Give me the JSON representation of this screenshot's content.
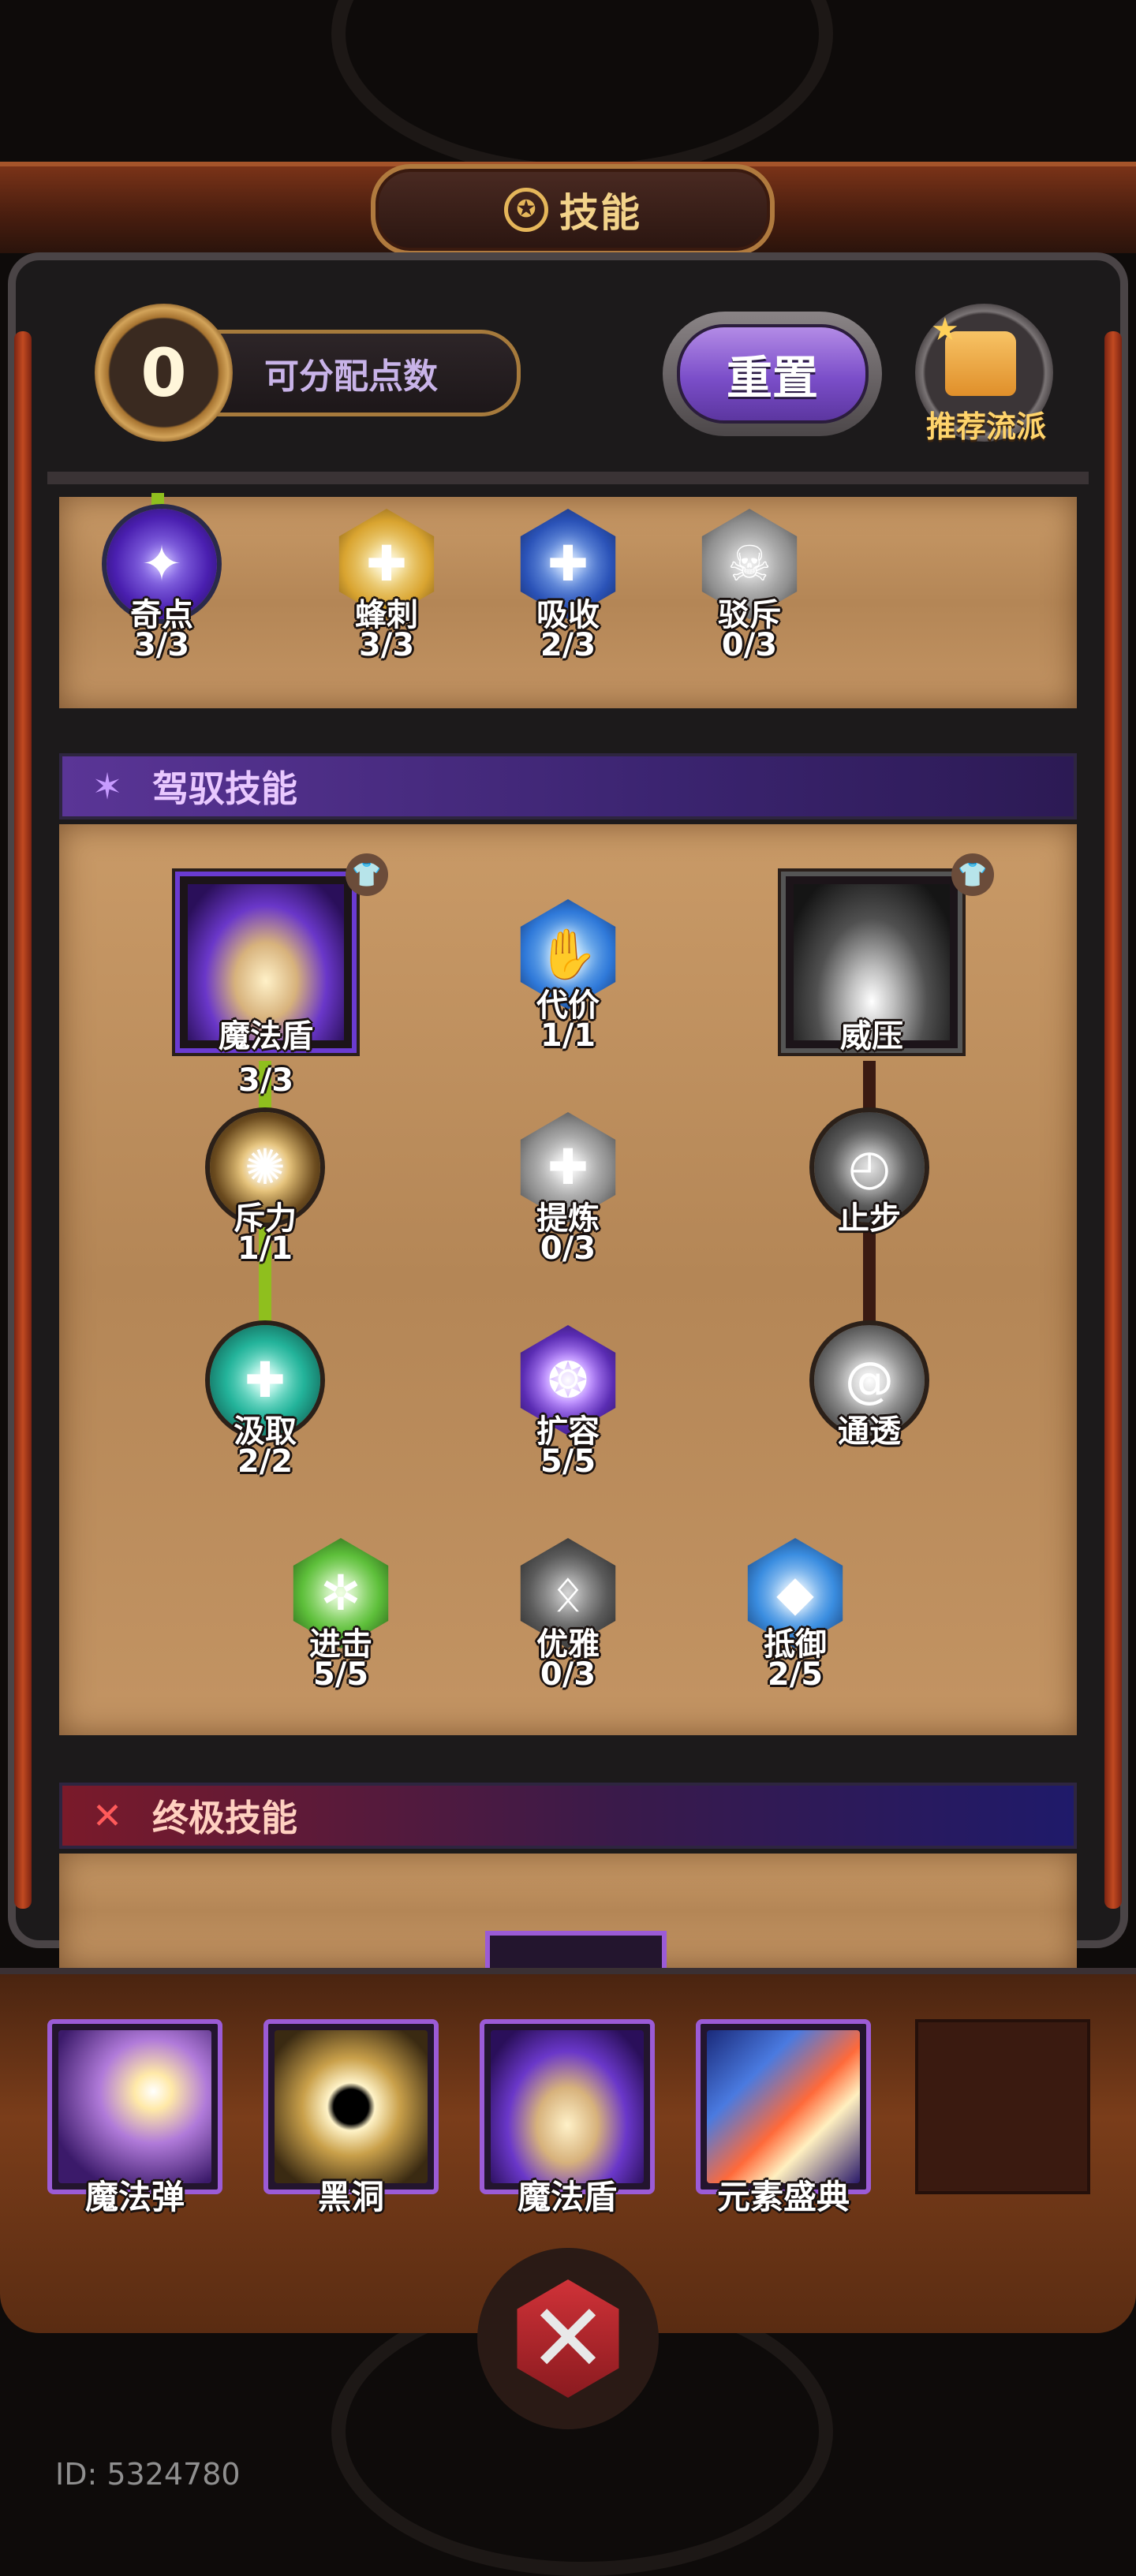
{
  "header": {
    "title": "技能",
    "title_icon": "star-emblem-icon"
  },
  "points": {
    "available": "0",
    "label": "可分配点数"
  },
  "reset_button": "重置",
  "recommend_label": "推荐流派",
  "top_row_skills": [
    {
      "name": "奇点",
      "level": "3/3",
      "icon": "sparkle-star-icon",
      "color": "#6a3bd1"
    },
    {
      "name": "蜂刺",
      "level": "3/3",
      "icon": "golden-orb-icon",
      "color": "#d9b24a"
    },
    {
      "name": "吸收",
      "level": "2/3",
      "icon": "blue-cross-icon",
      "color": "#2b53b8"
    },
    {
      "name": "驳斥",
      "level": "0/3",
      "icon": "skull-ring-icon",
      "color": "#8f8f8f"
    }
  ],
  "control_section": {
    "title": "驾驭技能",
    "icon": "purple-star-icon",
    "big_skills": [
      {
        "name": "魔法盾",
        "level": "3/3",
        "icon": "magic-shield-dome-icon"
      },
      {
        "name": "威压",
        "level": "",
        "icon": "white-pillar-icon"
      }
    ],
    "skills": [
      {
        "name": "代价",
        "level": "1/1",
        "icon": "blue-hand-icon"
      },
      {
        "name": "斥力",
        "level": "1/1",
        "icon": "golden-burst-icon"
      },
      {
        "name": "提炼",
        "level": "0/3",
        "icon": "gray-cross-icon"
      },
      {
        "name": "止步",
        "level": "",
        "icon": "clock-hand-icon"
      },
      {
        "name": "汲取",
        "level": "2/2",
        "icon": "teal-cross-icon"
      },
      {
        "name": "扩容",
        "level": "5/5",
        "icon": "purple-orb-icon"
      },
      {
        "name": "通透",
        "level": "",
        "icon": "swirl-icon"
      },
      {
        "name": "进击",
        "level": "5/5",
        "icon": "green-crack-icon"
      },
      {
        "name": "优雅",
        "level": "0/3",
        "icon": "gray-rune-icon"
      },
      {
        "name": "抵御",
        "level": "2/5",
        "icon": "blue-diamond-icon"
      }
    ]
  },
  "ultimate_section": {
    "title": "终极技能",
    "icon": "red-x-icon"
  },
  "equipped_slots": [
    {
      "name": "魔法弹",
      "icon": "magic-bolt-icon"
    },
    {
      "name": "黑洞",
      "icon": "black-hole-icon"
    },
    {
      "name": "魔法盾",
      "icon": "magic-shield-icon"
    },
    {
      "name": "元素盛典",
      "icon": "element-rain-icon"
    }
  ],
  "footer": {
    "id_text": "ID: 5324780"
  }
}
